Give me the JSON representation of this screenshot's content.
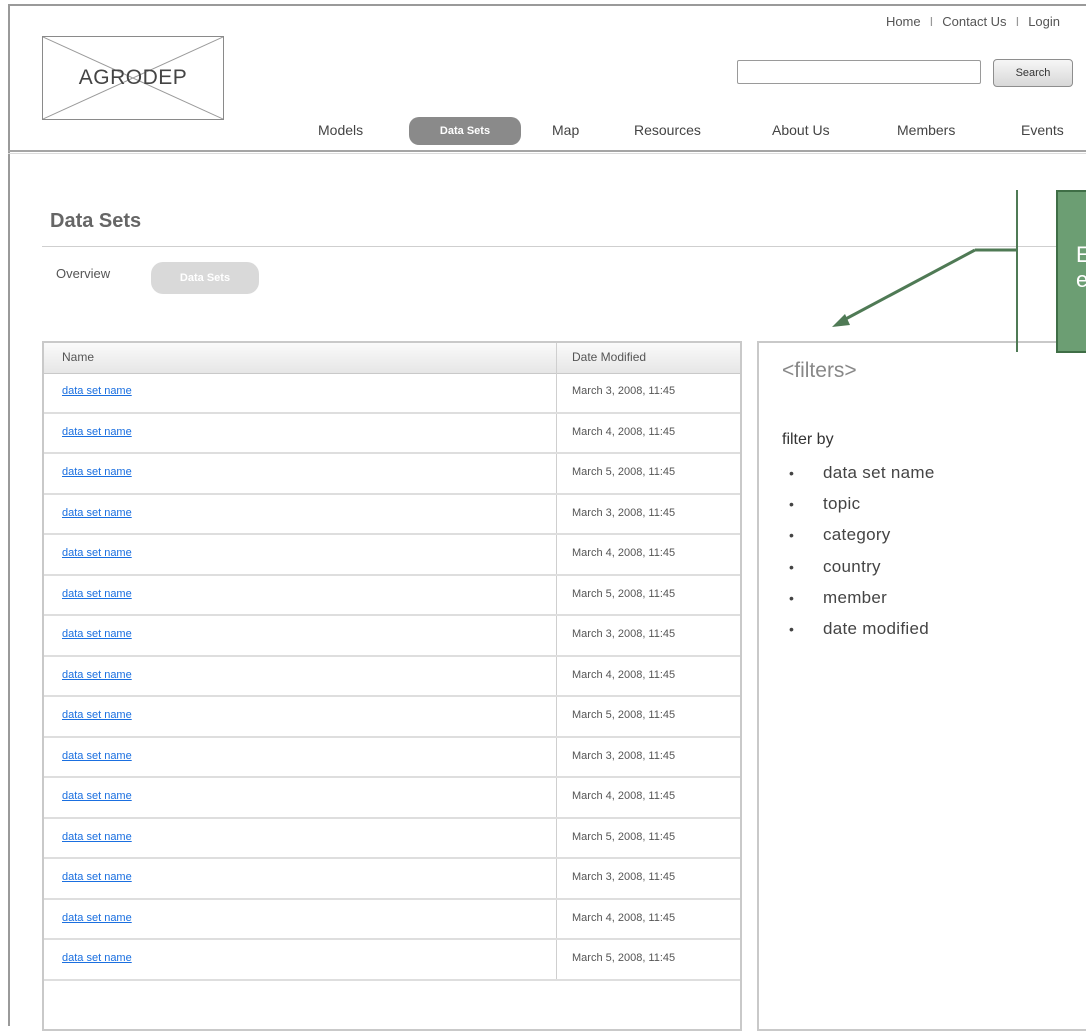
{
  "header": {
    "logo_text": "AGRODEP",
    "top_links": [
      "Home",
      "Contact Us",
      "Login"
    ],
    "top_link_separator": "I",
    "search": {
      "button_label": "Search",
      "value": ""
    },
    "nav": [
      {
        "label": "Models",
        "active": false
      },
      {
        "label": "Data Sets",
        "active": true
      },
      {
        "label": "Map",
        "active": false
      },
      {
        "label": "Resources",
        "active": false
      },
      {
        "label": "About Us",
        "active": false
      },
      {
        "label": "Members",
        "active": false
      },
      {
        "label": "Events",
        "active": false
      }
    ]
  },
  "page": {
    "title": "Data Sets",
    "tabs": [
      {
        "label": "Overview",
        "active": false
      },
      {
        "label": "Data Sets",
        "active": true
      }
    ]
  },
  "table": {
    "columns": [
      "Name",
      "Date Modified"
    ],
    "rows": [
      {
        "name": "data set name",
        "date": "March 3, 2008, 11:45"
      },
      {
        "name": "data set name",
        "date": "March 4, 2008, 11:45"
      },
      {
        "name": "data set name",
        "date": "March 5, 2008, 11:45"
      },
      {
        "name": "data set name",
        "date": "March 3, 2008, 11:45"
      },
      {
        "name": "data set name",
        "date": "March 4, 2008, 11:45"
      },
      {
        "name": "data set name",
        "date": "March 5, 2008, 11:45"
      },
      {
        "name": "data set name",
        "date": "March 3, 2008, 11:45"
      },
      {
        "name": "data set name",
        "date": "March 4, 2008, 11:45"
      },
      {
        "name": "data set name",
        "date": "March 5, 2008, 11:45"
      },
      {
        "name": "data set name",
        "date": "March 3, 2008, 11:45"
      },
      {
        "name": "data set name",
        "date": "March 4, 2008, 11:45"
      },
      {
        "name": "data set name",
        "date": "March 5, 2008, 11:45"
      },
      {
        "name": "data set name",
        "date": "March 3, 2008, 11:45"
      },
      {
        "name": "data set name",
        "date": "March 4, 2008, 11:45"
      },
      {
        "name": "data set name",
        "date": "March 5, 2008, 11:45"
      }
    ]
  },
  "filters": {
    "title": "<filters>",
    "filter_by_label": "filter by",
    "bullet": "•",
    "options": [
      "data set name",
      "topic",
      "category",
      "country",
      "member",
      "date modified"
    ]
  },
  "annotation": {
    "line1": "E",
    "line2": "e"
  },
  "colors": {
    "link": "#1a6fe0",
    "nav_active_bg": "#8a8a8a",
    "tab_active_bg": "#d9d9d9",
    "annotation_bg": "#6c9e73",
    "annotation_arrow": "#4f7a55"
  }
}
